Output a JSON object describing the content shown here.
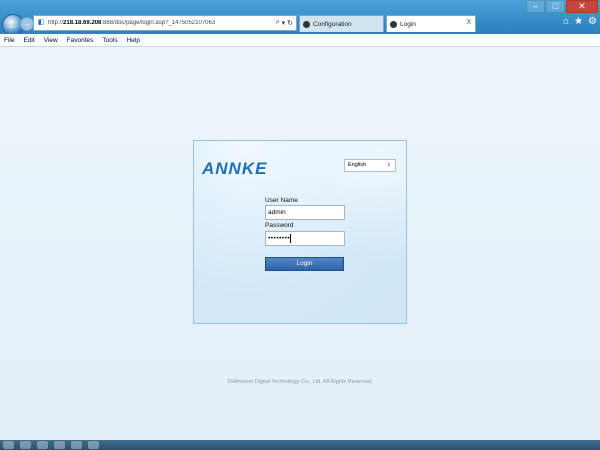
{
  "browser": {
    "window_controls": [
      "–",
      "□",
      "✕"
    ],
    "address": {
      "scheme": "http://",
      "host": "218.18.69.208",
      "rest": ":888/doc/page/login.asp?_1475052107063",
      "tools": [
        "⌕",
        "▾",
        "↻"
      ]
    },
    "tabs": [
      {
        "label": "Configuration",
        "active": false
      },
      {
        "label": "Login",
        "active": true,
        "close": "X"
      }
    ],
    "right_icons": [
      "home-icon",
      "star-icon",
      "gear-icon"
    ],
    "menu": [
      "File",
      "Edit",
      "View",
      "Favorites",
      "Tools",
      "Help"
    ]
  },
  "login": {
    "logo": "ANNKE",
    "language": "English",
    "user_label": "User Name",
    "user_value": "admin",
    "password_label": "Password",
    "password_mask": "••••••••",
    "button": "Login"
  },
  "footer": {
    "copyright": "©Hikvision Digital Technology Co., Ltd. All Rights Reserved."
  },
  "colors": {
    "chrome": "#2f86c2",
    "logo": "#1e70b8",
    "button": "#2f64a8",
    "page_bg": "#e9f3fa"
  }
}
